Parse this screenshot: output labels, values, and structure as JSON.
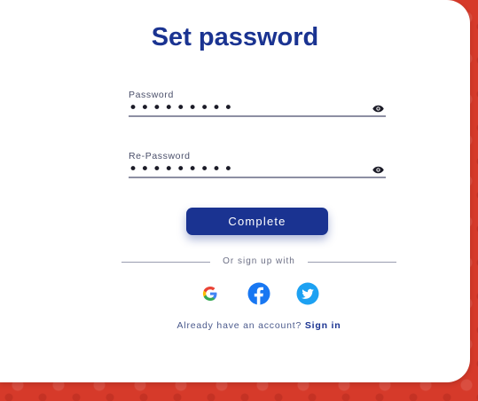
{
  "title": "Set password",
  "fields": [
    {
      "label": "Password",
      "value": "•••••••••"
    },
    {
      "label": "Re-Password",
      "value": "•••••••••"
    }
  ],
  "icons": {
    "visibility": "eye-icon",
    "google": "google-icon",
    "facebook": "facebook-icon",
    "twitter": "twitter-icon"
  },
  "complete_label": "Complete",
  "divider_text": "Or sign up with",
  "footer": {
    "prompt": "Already have an account?",
    "link": "Sign in"
  },
  "colors": {
    "primary": "#1a3391",
    "background": "#d63a2a",
    "facebook": "#1877f2",
    "twitter": "#1da1f2"
  }
}
